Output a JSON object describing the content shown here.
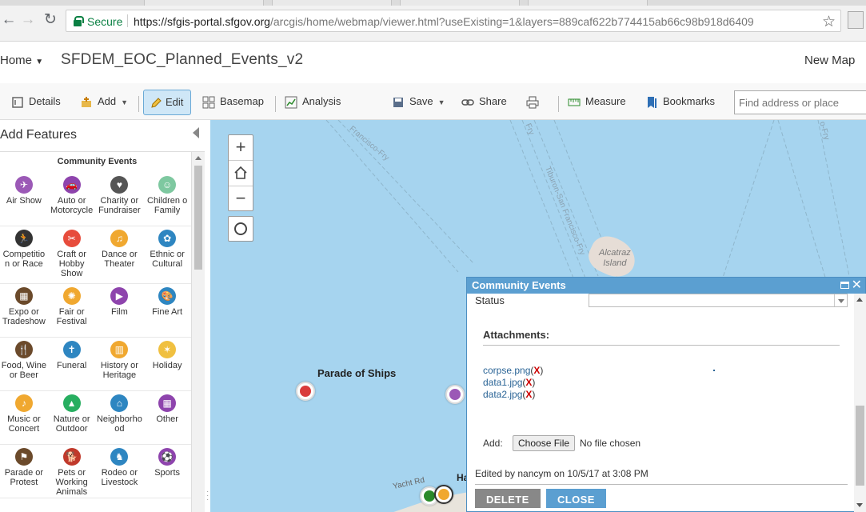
{
  "browser": {
    "secure_label": "Secure",
    "url_host": "https://sfgis-portal.sfgov.org",
    "url_path": "/arcgis/home/webmap/viewer.html?useExisting=1&layers=889caf622b774415ab66c98b918d6409"
  },
  "header": {
    "home_label": "Home",
    "map_title": "SFDEM_EOC_Planned_Events_v2",
    "new_map_label": "New Map"
  },
  "toolbar": {
    "details": "Details",
    "add": "Add",
    "edit": "Edit",
    "basemap": "Basemap",
    "analysis": "Analysis",
    "save": "Save",
    "share": "Share",
    "measure": "Measure",
    "bookmarks": "Bookmarks",
    "find_placeholder": "Find address or place"
  },
  "panel": {
    "title": "Add Features",
    "group_title": "Community Events",
    "items": [
      {
        "label": "Air Show",
        "color": "#9b59b6",
        "glyph": "✈"
      },
      {
        "label": "Auto or\nMotorcycle",
        "color": "#8e44ad",
        "glyph": "🚗"
      },
      {
        "label": "Charity or\nFundraiser",
        "color": "#555555",
        "glyph": "♥"
      },
      {
        "label": "Children o\nFamily",
        "color": "#7ec8a0",
        "glyph": "☺"
      },
      {
        "label": "Competitio\nn or Race",
        "color": "#333333",
        "glyph": "🏃"
      },
      {
        "label": "Craft or\nHobby\nShow",
        "color": "#e74c3c",
        "glyph": "✂"
      },
      {
        "label": "Dance or\nTheater",
        "color": "#f0a830",
        "glyph": "♫"
      },
      {
        "label": "Ethnic or\nCultural",
        "color": "#2e86c1",
        "glyph": "✿"
      },
      {
        "label": "Expo or\nTradeshow",
        "color": "#6b4a2b",
        "glyph": "▦"
      },
      {
        "label": "Fair or\nFestival",
        "color": "#f0a830",
        "glyph": "✺"
      },
      {
        "label": "Film",
        "color": "#8e44ad",
        "glyph": "▶"
      },
      {
        "label": "Fine Art",
        "color": "#2e86c1",
        "glyph": "🎨"
      },
      {
        "label": "Food, Wine\nor Beer",
        "color": "#6b4a2b",
        "glyph": "🍴"
      },
      {
        "label": "Funeral",
        "color": "#2e86c1",
        "glyph": "✝"
      },
      {
        "label": "History or\nHeritage",
        "color": "#f0a830",
        "glyph": "▥"
      },
      {
        "label": "Holiday",
        "color": "#f0c040",
        "glyph": "✶"
      },
      {
        "label": "Music or\nConcert",
        "color": "#f0a830",
        "glyph": "♪"
      },
      {
        "label": "Nature or\nOutdoor",
        "color": "#27ae60",
        "glyph": "▲"
      },
      {
        "label": "Neighborho\nod",
        "color": "#2e86c1",
        "glyph": "⌂"
      },
      {
        "label": "Other",
        "color": "#8e44ad",
        "glyph": "▦"
      },
      {
        "label": "Parade or\nProtest",
        "color": "#6b4a2b",
        "glyph": "⚑"
      },
      {
        "label": "Pets or\nWorking\nAnimals",
        "color": "#c0392b",
        "glyph": "🐕"
      },
      {
        "label": "Rodeo or\nLivestock",
        "color": "#2e86c1",
        "glyph": "♞"
      },
      {
        "label": "Sports",
        "color": "#8e44ad",
        "glyph": "⚽"
      }
    ]
  },
  "map": {
    "labels": [
      "Francisco-Fry",
      "Fry",
      "Tiburon-San Francisco-Fry",
      "o-Fry"
    ],
    "alcatraz_label": "Alcatraz\nIsland",
    "parade_label": "Parade of Ships",
    "road_label": "Yacht Rd",
    "partial_label": "Ha"
  },
  "popup": {
    "title": "Community Events",
    "status_label": "Status",
    "status_value": "",
    "attachments_label": "Attachments:",
    "attachments": [
      "corpse.png",
      "data1.jpg",
      "data2.jpg"
    ],
    "remove_glyph": "X",
    "add_label": "Add:",
    "choose_file_label": "Choose File",
    "no_file_label": "No file chosen",
    "edited_text": "Edited by nancym on 10/5/17 at 3:08 PM",
    "delete_label": "DELETE",
    "close_label": "CLOSE"
  }
}
